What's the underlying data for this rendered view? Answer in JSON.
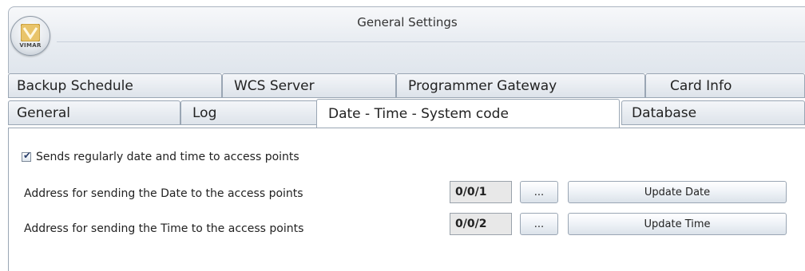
{
  "window": {
    "title": "General Settings"
  },
  "app_button": {
    "logo_text": "VIMAR"
  },
  "tabs": {
    "row_top": [
      "Backup Schedule",
      "WCS Server",
      "Programmer Gateway",
      "Card Info"
    ],
    "row_bottom": [
      "General",
      "Log",
      "Date - Time - System code",
      "Database"
    ],
    "active": "Date - Time - System code"
  },
  "settings": {
    "send_regularly": {
      "label": "Sends regularly date and time to access points",
      "checked": true
    },
    "date_row": {
      "label": "Address for sending the Date to the access points",
      "value": "0/0/1",
      "browse_label": "...",
      "update_label": "Update Date"
    },
    "time_row": {
      "label": "Address for sending the Time to the access points",
      "value": "0/0/2",
      "browse_label": "...",
      "update_label": "Update Time"
    }
  }
}
